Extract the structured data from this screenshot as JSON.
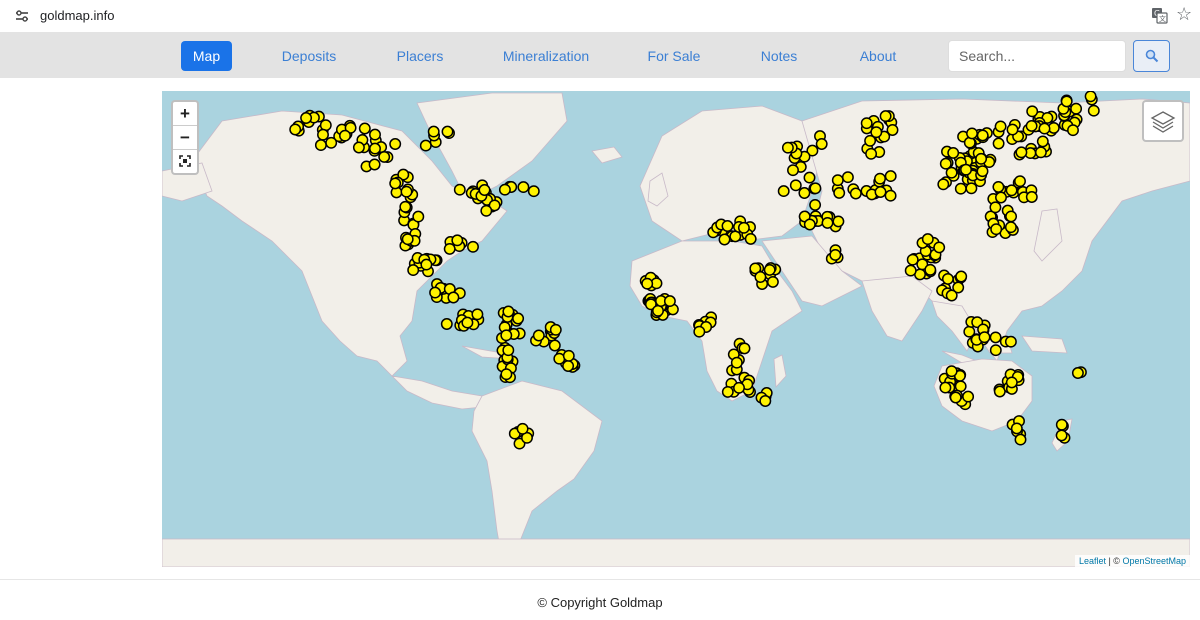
{
  "browser": {
    "url": "goldmap.info",
    "icons": [
      "site-settings-icon",
      "translate-icon",
      "bookmark-star-icon"
    ]
  },
  "nav": {
    "items": [
      {
        "label": "Map",
        "active": true
      },
      {
        "label": "Deposits"
      },
      {
        "label": "Placers"
      },
      {
        "label": "Mineralization"
      },
      {
        "label": "For Sale"
      },
      {
        "label": "Notes"
      },
      {
        "label": "About"
      }
    ],
    "search_placeholder": "Search...",
    "search_icon": "magnifier-icon",
    "active_color": "#1a73e8",
    "link_color": "#3b7fd4"
  },
  "map": {
    "zoom_in": "+",
    "zoom_out": "−",
    "fullscreen_icon": "fullscreen-icon",
    "layers_icon": "layers-icon",
    "marker_color": "#fff200",
    "marker_stroke": "#000000",
    "attribution_leaflet": "Leaflet",
    "attribution_sep": " | © ",
    "attribution_osm": "OpenStreetMap"
  },
  "footer": {
    "text": "© Copyright Goldmap"
  }
}
